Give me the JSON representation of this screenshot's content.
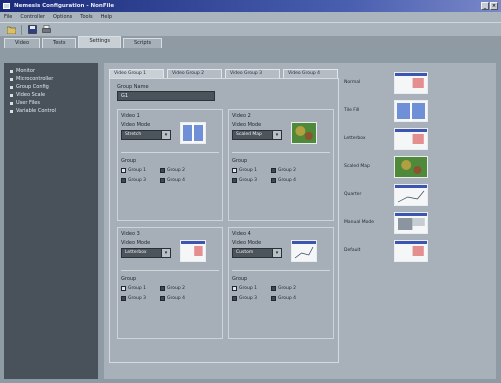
{
  "window": {
    "title": "Nemesis Configuration - NonFile"
  },
  "menu": {
    "items": [
      "File",
      "Controller",
      "Options",
      "Tools",
      "Help"
    ]
  },
  "toolbar": {
    "icons": [
      "open-file-icon",
      "save-icon",
      "print-icon"
    ]
  },
  "main_tabs": [
    {
      "label": "Video",
      "active": false
    },
    {
      "label": "Tests",
      "active": false
    },
    {
      "label": "Settings",
      "active": true
    },
    {
      "label": "Scripts",
      "active": false
    }
  ],
  "sidebar": {
    "items": [
      {
        "label": "Monitor"
      },
      {
        "label": "Microcontroller"
      },
      {
        "label": "Group Config"
      },
      {
        "label": "Video Scale"
      },
      {
        "label": "User Files"
      },
      {
        "label": "Variable Control"
      }
    ]
  },
  "subtabs": [
    {
      "label": "Video Group 1",
      "active": true
    },
    {
      "label": "Video Group 2",
      "active": false
    },
    {
      "label": "Video Group 3",
      "active": false
    },
    {
      "label": "Video Group 4",
      "active": false
    }
  ],
  "group_name": {
    "label": "Group Name",
    "value": "G1"
  },
  "quadrants": [
    {
      "title": "Video 1",
      "mode_label": "Video Mode",
      "mode_value": "Stretch",
      "thumb": "split",
      "group_label": "Group",
      "groups": [
        {
          "label": "Group 1",
          "checked": true
        },
        {
          "label": "Group 2",
          "checked": false
        },
        {
          "label": "Group 3",
          "checked": false
        },
        {
          "label": "Group 4",
          "checked": false
        }
      ]
    },
    {
      "title": "Video 2",
      "mode_label": "Video Mode",
      "mode_value": "Scaled Map",
      "thumb": "map",
      "group_label": "Group",
      "groups": [
        {
          "label": "Group 1",
          "checked": true
        },
        {
          "label": "Group 2",
          "checked": false
        },
        {
          "label": "Group 3",
          "checked": false
        },
        {
          "label": "Group 4",
          "checked": false
        }
      ]
    },
    {
      "title": "Video 3",
      "mode_label": "Video Mode",
      "mode_value": "Letterbox",
      "thumb": "window",
      "group_label": "Group",
      "groups": [
        {
          "label": "Group 1",
          "checked": true
        },
        {
          "label": "Group 2",
          "checked": false
        },
        {
          "label": "Group 3",
          "checked": false
        },
        {
          "label": "Group 4",
          "checked": false
        }
      ]
    },
    {
      "title": "Video 4",
      "mode_label": "Video Mode",
      "mode_value": "Custom",
      "thumb": "chart",
      "group_label": "Group",
      "groups": [
        {
          "label": "Group 1",
          "checked": true
        },
        {
          "label": "Group 2",
          "checked": false
        },
        {
          "label": "Group 3",
          "checked": false
        },
        {
          "label": "Group 4",
          "checked": false
        }
      ]
    }
  ],
  "preview_modes": [
    {
      "label": "Normal",
      "thumb": "window"
    },
    {
      "label": "Tile Fill",
      "thumb": "split"
    },
    {
      "label": "Letterbox",
      "thumb": "window"
    },
    {
      "label": "Scaled Map",
      "thumb": "map"
    },
    {
      "label": "Quarter",
      "thumb": "chart"
    },
    {
      "label": "Manual Mode",
      "thumb": "panel"
    },
    {
      "label": "Default",
      "thumb": "window"
    }
  ],
  "colors": {
    "accent": "#1a2a7a",
    "panel": "#a8b1b9",
    "sidebar": "#49525b",
    "map": "#4f8a3a"
  }
}
